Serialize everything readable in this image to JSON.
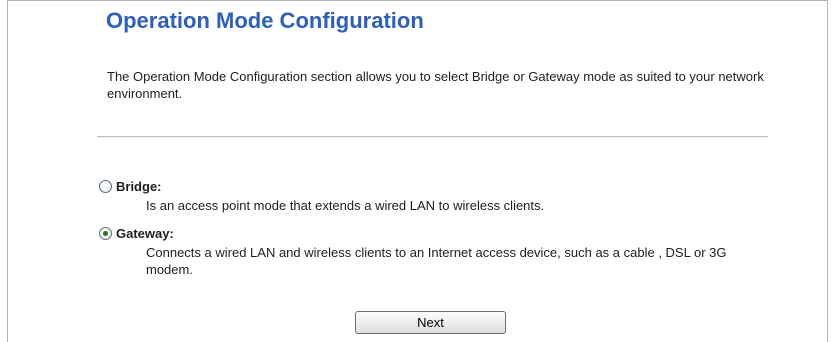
{
  "page": {
    "title": "Operation Mode Configuration",
    "description": "The Operation Mode Configuration section allows you to select Bridge or Gateway mode as suited to your network environment."
  },
  "options": [
    {
      "label": "Bridge:",
      "description": "Is an access point mode that extends a wired LAN to wireless clients.",
      "selected": false
    },
    {
      "label": "Gateway:",
      "description": "Connects a wired LAN and wireless clients to an Internet access device, such as a cable , DSL or 3G modem.",
      "selected": true
    }
  ],
  "actions": {
    "next_label": "Next"
  },
  "colors": {
    "title": "#2e5fbd",
    "text": "#1e1e1e",
    "divider": "#bdbdbd",
    "radio_selected": "#1f7a1f"
  }
}
